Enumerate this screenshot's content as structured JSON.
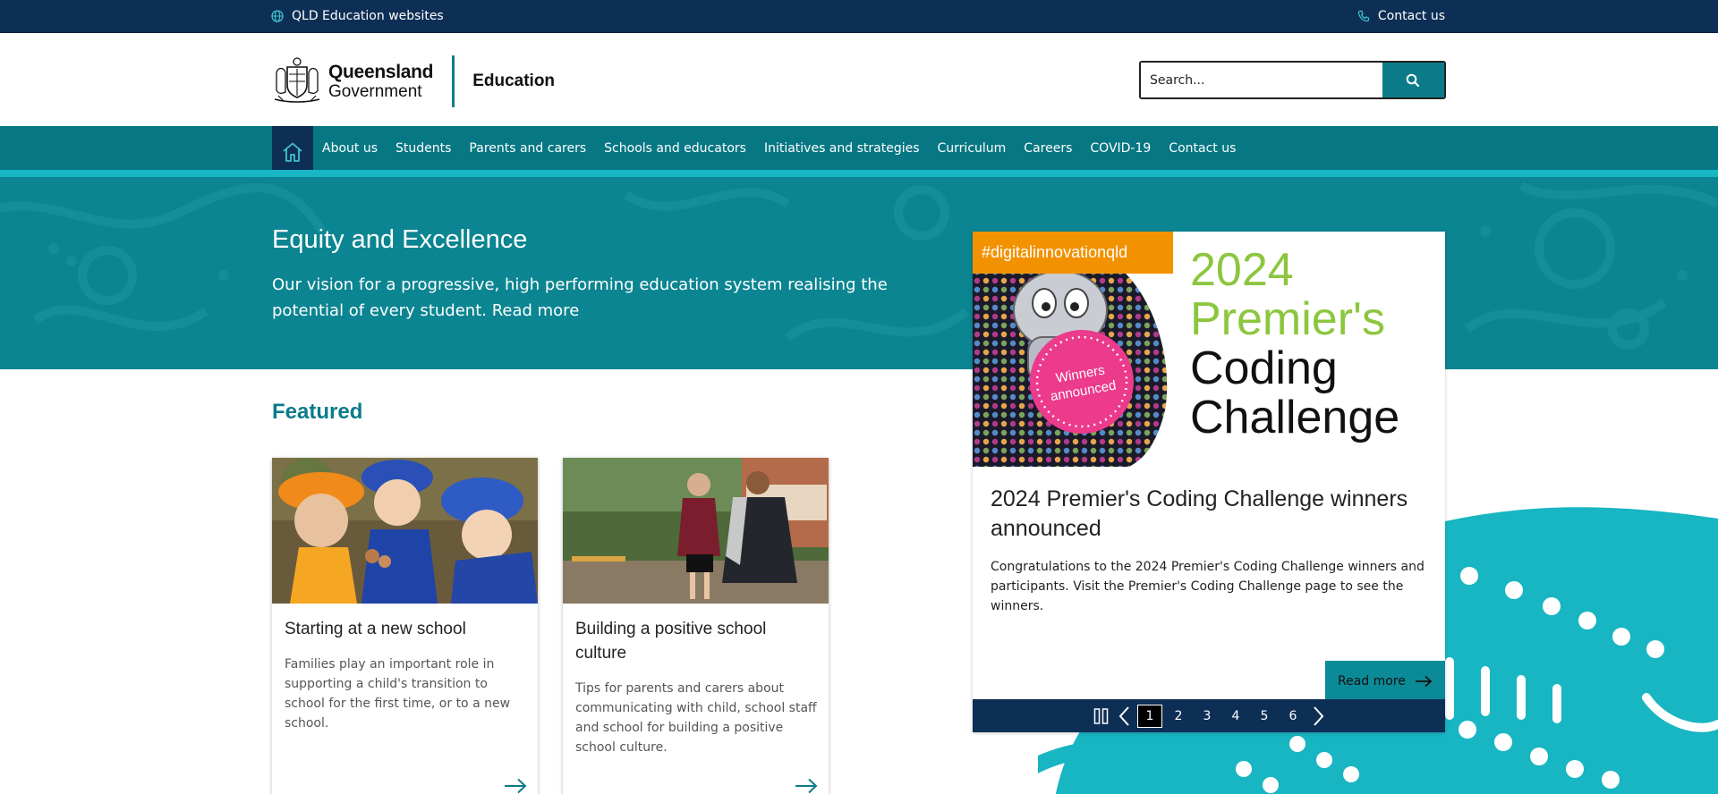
{
  "utility": {
    "sites_label": "QLD Education websites",
    "contact_label": "Contact us"
  },
  "header": {
    "brand_line1": "Queensland",
    "brand_line2": "Government",
    "department": "Education",
    "search_placeholder": "Search..."
  },
  "nav": {
    "items": [
      "About us",
      "Students",
      "Parents and carers",
      "Schools and educators",
      "Initiatives and strategies",
      "Curriculum",
      "Careers",
      "COVID-19",
      "Contact us"
    ]
  },
  "hero": {
    "title": "Equity and Excellence",
    "text": "Our vision for a progressive, high performing education system realising the potential of every student. Read more"
  },
  "featured": {
    "title": "Featured",
    "cards": [
      {
        "title": "Starting at a new school",
        "text": "Families play an important role in supporting a child's transition to school for the first time, or to a new school."
      },
      {
        "title": "Building a positive school culture",
        "text": "Tips for parents and carers about communicating with child, school staff and school for building a positive school culture."
      }
    ]
  },
  "carousel": {
    "tag": "#digitalinnovationqld",
    "banner_year": "2024",
    "banner_line2": "Premier's",
    "banner_line3": "Coding",
    "banner_line4": "Challenge",
    "badge_line1": "Winners",
    "badge_line2": "announced",
    "title": "2024 Premier's Coding Challenge winners announced",
    "text": "Congratulations to the 2024 Premier's Coding Challenge winners and participants. Visit the Premier's Coding Challenge page to see the winners.",
    "read_more": "Read more",
    "pages": [
      "1",
      "2",
      "3",
      "4",
      "5",
      "6"
    ],
    "active_page": "1"
  },
  "colors": {
    "navy": "#0e2f55",
    "teal": "#077784",
    "teal_light": "#18b5c2",
    "orange": "#f39200",
    "green": "#8cc63f",
    "pink": "#ec3a8c"
  }
}
